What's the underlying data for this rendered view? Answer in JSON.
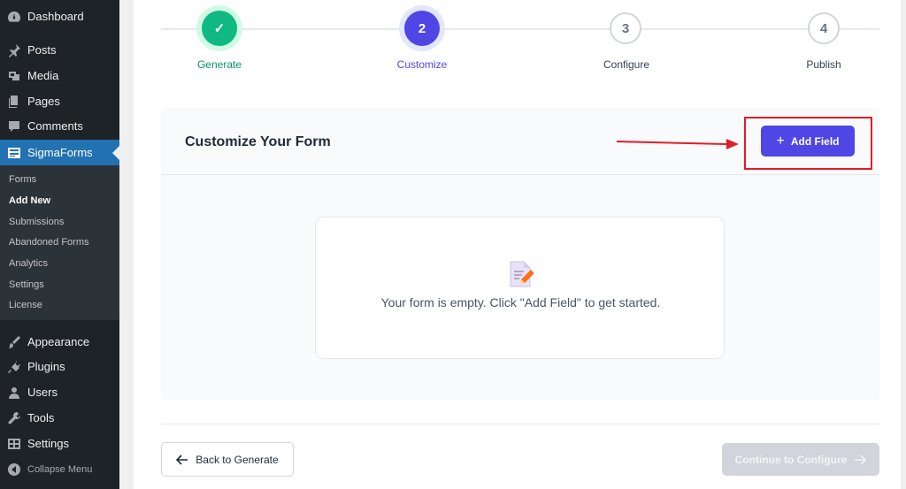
{
  "sidebar": {
    "top_items": [
      {
        "label": "Dashboard",
        "icon": "dashboard-icon"
      },
      {
        "label": "Posts",
        "icon": "pin-icon"
      },
      {
        "label": "Media",
        "icon": "media-icon"
      },
      {
        "label": "Pages",
        "icon": "pages-icon"
      },
      {
        "label": "Comments",
        "icon": "comments-icon"
      },
      {
        "label": "SigmaForms",
        "icon": "form-icon"
      }
    ],
    "submenu": [
      "Forms",
      "Add New",
      "Submissions",
      "Abandoned Forms",
      "Analytics",
      "Settings",
      "License"
    ],
    "bottom_items": [
      {
        "label": "Appearance",
        "icon": "brush-icon"
      },
      {
        "label": "Plugins",
        "icon": "plug-icon"
      },
      {
        "label": "Users",
        "icon": "user-icon"
      },
      {
        "label": "Tools",
        "icon": "wrench-icon"
      },
      {
        "label": "Settings",
        "icon": "settings-icon"
      }
    ],
    "collapse_label": "Collapse Menu"
  },
  "stepper": {
    "steps": [
      {
        "number": "✓",
        "label": "Generate",
        "state": "done"
      },
      {
        "number": "2",
        "label": "Customize",
        "state": "current"
      },
      {
        "number": "3",
        "label": "Configure",
        "state": "todo"
      },
      {
        "number": "4",
        "label": "Publish",
        "state": "todo"
      }
    ]
  },
  "card": {
    "title": "Customize Your Form",
    "add_field_label": "Add Field",
    "empty_message": "Your form is empty. Click \"Add Field\" to get started."
  },
  "footer": {
    "back_label": "Back to Generate",
    "continue_label": "Continue to Configure"
  },
  "colors": {
    "accent": "#4f46e5",
    "success": "#10b981",
    "sidebar_bg": "#1d2327",
    "wp_blue": "#2271b1",
    "annotation_red": "#e11d26"
  }
}
